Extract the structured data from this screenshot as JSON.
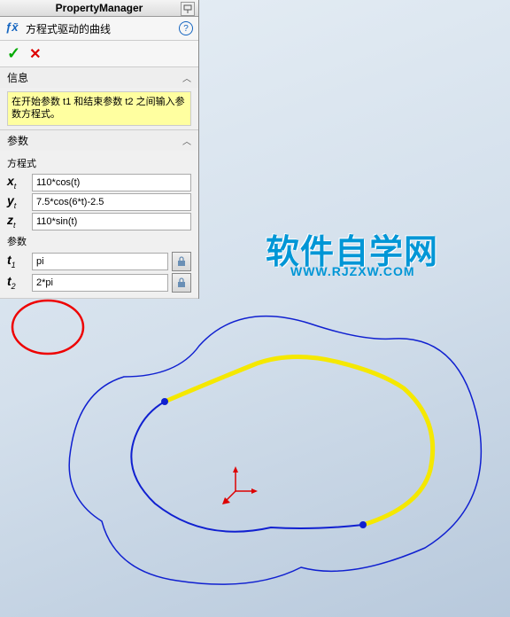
{
  "header": {
    "title": "PropertyManager"
  },
  "feature": {
    "name": "方程式驱动的曲线"
  },
  "sections": {
    "info": {
      "title": "信息",
      "text": "在开始参数 t1 和结束参数 t2 之间输入参数方程式。"
    },
    "params": {
      "title": "参数",
      "equation_label": "方程式",
      "eq_x": "110*cos(t)",
      "eq_y": "7.5*cos(6*t)-2.5",
      "eq_z": "110*sin(t)",
      "param_label": "参数",
      "t1": "pi",
      "t2": "2*pi"
    }
  },
  "watermark": {
    "main": "软件自学网",
    "sub": "WWW.RJZXW.COM"
  },
  "vars": {
    "x": "x",
    "y": "y",
    "z": "z",
    "t": "t",
    "t1": "t",
    "t2": "t",
    "sub_t": "t",
    "sub_1": "1",
    "sub_2": "2"
  }
}
